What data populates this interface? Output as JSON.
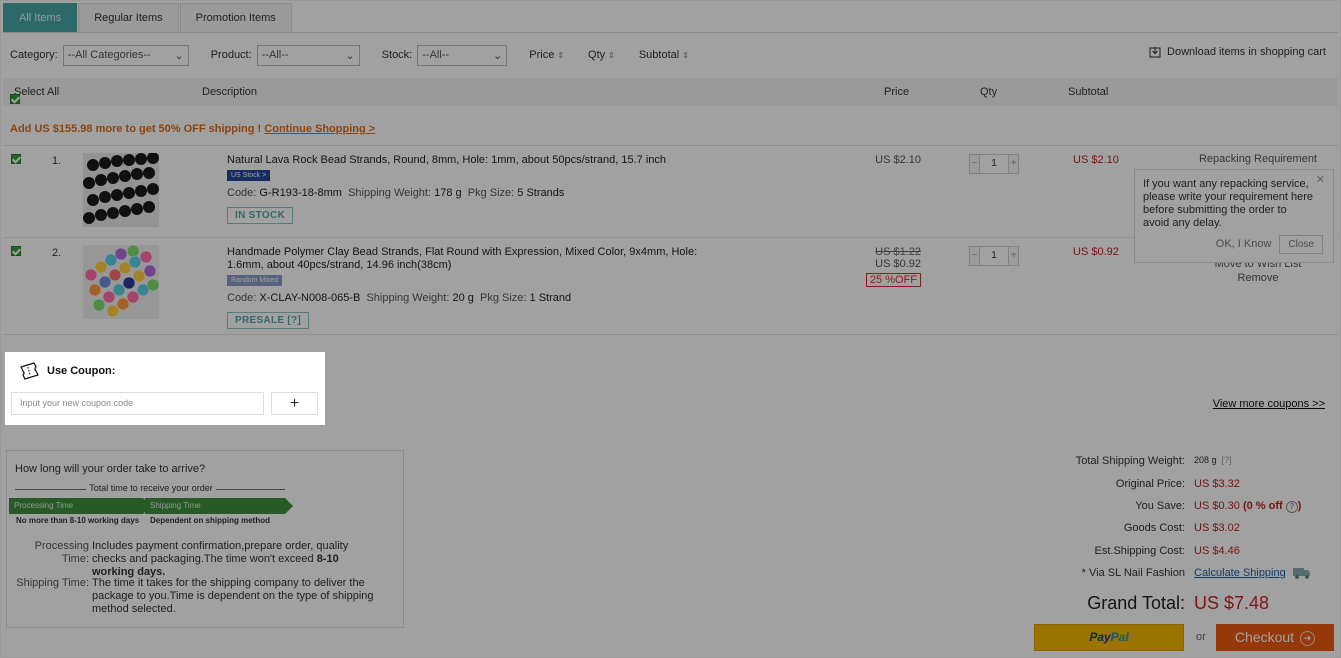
{
  "tabs": [
    "All Items",
    "Regular Items",
    "Promotion Items"
  ],
  "filters": {
    "category_label": "Category:",
    "category_value": "--All Categories--",
    "product_label": "Product:",
    "product_value": "--All--",
    "stock_label": "Stock:",
    "stock_value": "--All--",
    "sort_price": "Price",
    "sort_qty": "Qty",
    "sort_subtotal": "Subtotal",
    "download": "Download items in shopping cart"
  },
  "table_header": {
    "select_all": "Select All",
    "description": "Description",
    "price": "Price",
    "qty": "Qty",
    "subtotal": "Subtotal"
  },
  "promo": {
    "text": "Add US $155.98 more to get 50% OFF shipping ! ",
    "link": "Continue Shopping >"
  },
  "items": [
    {
      "num": "1.",
      "title": "Natural Lava Rock Bead Strands, Round, 8mm, Hole: 1mm, about 50pcs/strand, 15.7 inch",
      "flag": "US Stock >",
      "code_label": "Code:",
      "code": "G-R193-18-8mm",
      "weight_label": "Shipping Weight:",
      "weight": "178 g",
      "pkg_label": "Pkg Size:",
      "pkg": "5 Strands",
      "stock": "IN STOCK",
      "price": "US $2.10",
      "qty": "1",
      "subtotal": "US $2.10",
      "op1": "Repacking Requirement"
    },
    {
      "num": "2.",
      "title": "Handmade Polymer Clay Bead Strands, Flat Round with Expression, Mixed Color, 9x4mm, Hole: 1.6mm, about 40pcs/strand, 14.96 inch(38cm)",
      "flag": "Random Mixed",
      "code_label": "Code:",
      "code": "X-CLAY-N008-065-B",
      "weight_label": "Shipping Weight:",
      "weight": "20 g",
      "pkg_label": "Pkg Size:",
      "pkg": "1 Strand",
      "stock": "PRESALE  [?]",
      "old_price": "US $1.22",
      "price": "US $0.92",
      "discount": "25 %OFF",
      "qty": "1",
      "subtotal": "US $0.92",
      "op1": "Move to Wish List",
      "op2": "Remove"
    }
  ],
  "tooltip": {
    "text": "If you want any repacking service, please write your requirement here before submitting the order to avoid any delay.",
    "ok": "OK, I Know",
    "close": "Close"
  },
  "coupon": {
    "title": "Use Coupon:",
    "placeholder": "Input your new coupon code",
    "add": "+",
    "view_more": "View more coupons >>"
  },
  "arrival": {
    "question": "How long will your order take to arrive?",
    "total_time": "Total time to receive your order",
    "processing": "Processing Time",
    "shipping": "Shipping Time",
    "processing_note": "No more than 8-10 working days",
    "shipping_note": "Dependent on shipping method",
    "proc_label_1": "Processing",
    "proc_label_2": "Time:",
    "proc_text": "Includes payment confirmation,prepare order, quality checks and packaging.The time won't exceed ",
    "proc_bold": "8-10 working days.",
    "ship_label": "Shipping Time:",
    "ship_text": "The time it takes for the shipping company to deliver the package to you.Time is dependent on the type of shipping method selected."
  },
  "summary": {
    "weight_label": "Total Shipping Weight:",
    "weight": "208 g",
    "weight_q": "[?]",
    "original_label": "Original Price:",
    "original": "US $3.32",
    "save_label": "You Save:",
    "save": "US $0.30",
    "save_pct": "(0 % off",
    "save_end": ")",
    "goods_label": "Goods Cost:",
    "goods": "US $3.02",
    "ship_label": "Est.Shipping Cost:",
    "ship": "US $4.46",
    "via_label": "* Via SL Nail Fashion",
    "calc": "Calculate Shipping",
    "grand_label": "Grand Total:",
    "grand": "US $7.48"
  },
  "paypal": {
    "pay": "Pay",
    "pal": "Pal"
  },
  "or": "or",
  "checkout": "Checkout"
}
